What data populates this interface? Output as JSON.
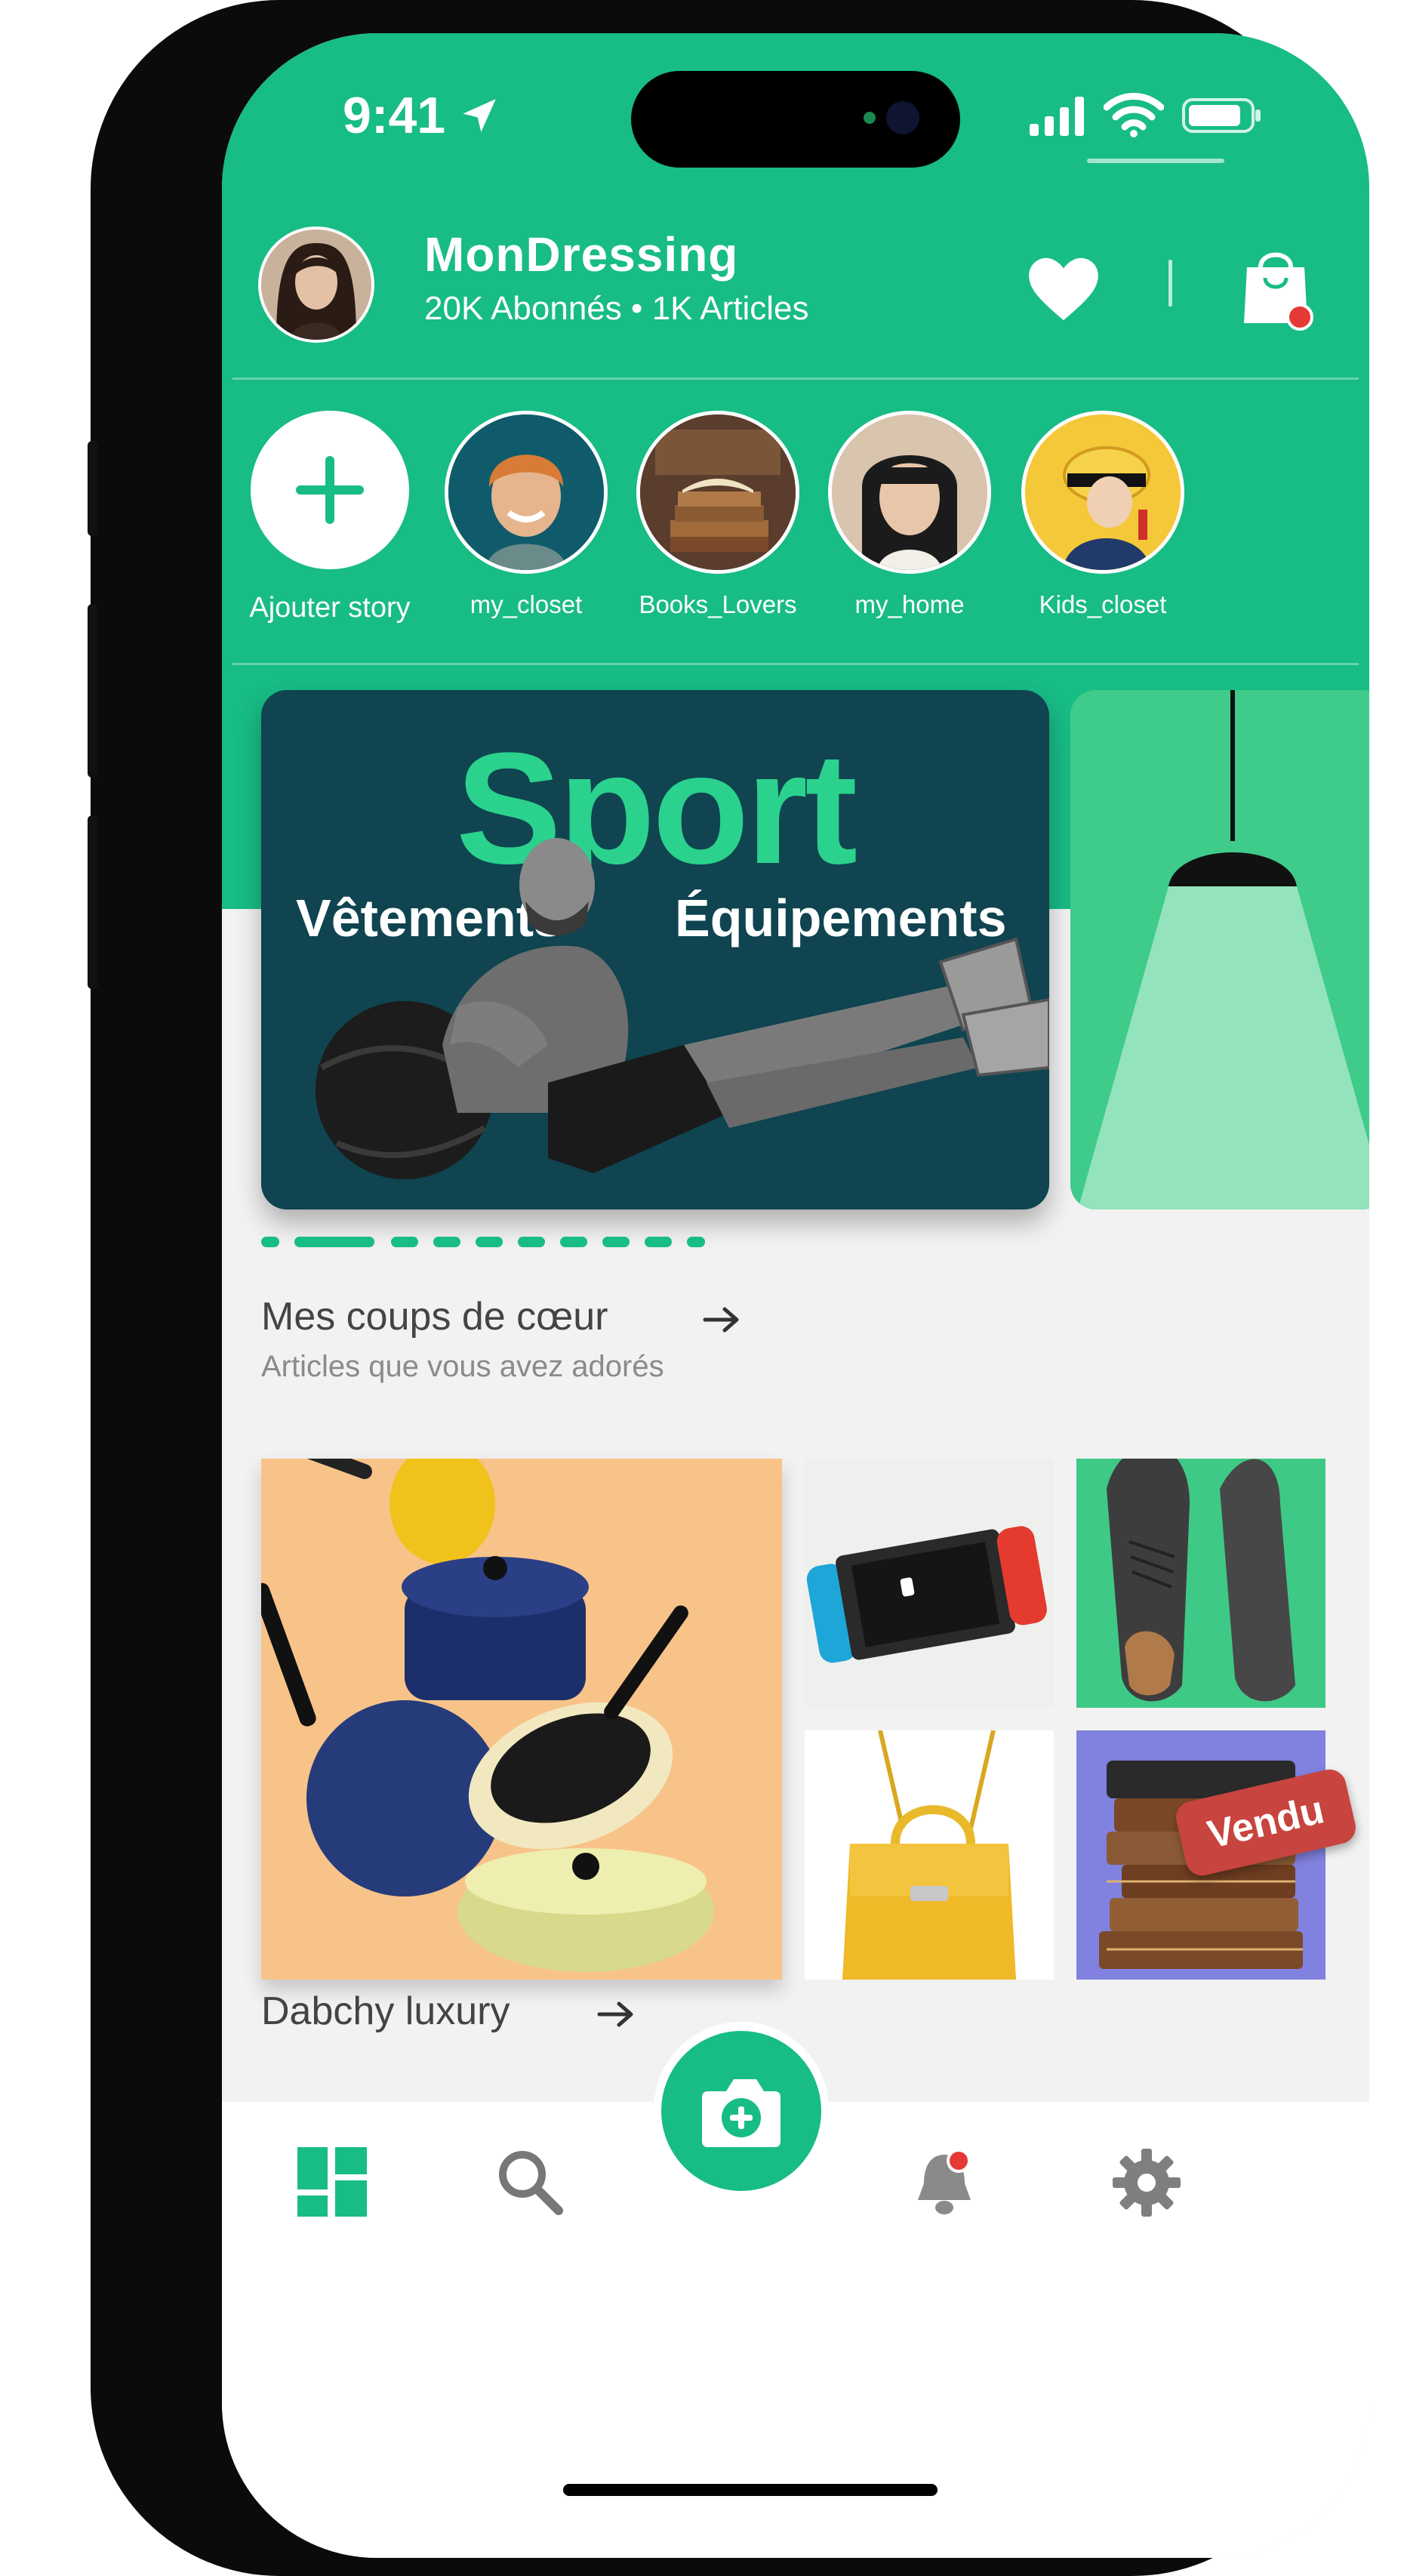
{
  "status_bar": {
    "time": "9:41"
  },
  "profile": {
    "name": "MonDressing",
    "stats": "20K Abonnés  •  1K Articles"
  },
  "stories": [
    {
      "label": "Ajouter story"
    },
    {
      "label": "my_closet"
    },
    {
      "label": "Books_Lovers"
    },
    {
      "label": "my_home"
    },
    {
      "label": "Kids_closet"
    }
  ],
  "banner": {
    "title": "Sport",
    "left_text": "Vêtements",
    "right_text": "Équipements",
    "active_index": 0,
    "total": 10
  },
  "favorites": {
    "title": "Mes coups de cœur",
    "subtitle": "Articles que vous avez adorés",
    "items": [
      {
        "name": "casseroles"
      },
      {
        "name": "nintendo-switch"
      },
      {
        "name": "chaussures"
      },
      {
        "name": "sac-jaune"
      },
      {
        "name": "livres",
        "badge": "Vendu"
      }
    ]
  },
  "section2": {
    "title": "Dabchy luxury"
  },
  "tabs": [
    {
      "name": "dashboard",
      "icon": "grid-icon",
      "active": true
    },
    {
      "name": "search",
      "icon": "search-icon"
    },
    {
      "name": "sell",
      "icon": "camera-plus-icon"
    },
    {
      "name": "notifications",
      "icon": "bell-icon",
      "badge": true
    },
    {
      "name": "settings",
      "icon": "gear-icon"
    }
  ],
  "colors": {
    "primary": "#18bc85",
    "banner_bg": "#0f4450",
    "badge": "#e53935",
    "sold": "#c8443f"
  }
}
